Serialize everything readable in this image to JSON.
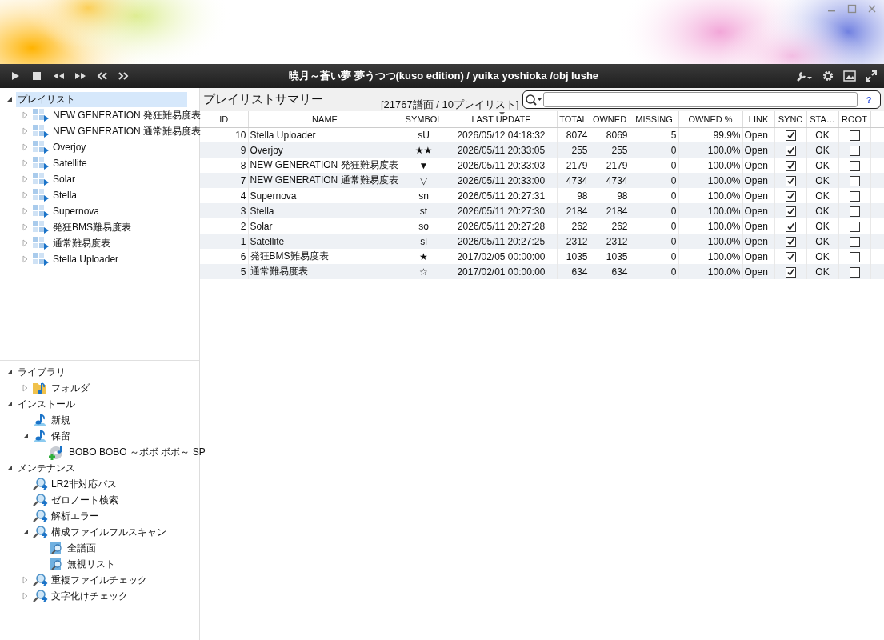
{
  "player": {
    "now_playing": "暁月～蒼い夢 夢うつつ(kuso edition) / yuika yoshioka /obj lushe"
  },
  "playlist_tree": [
    {
      "label": "プレイリスト",
      "selected": true,
      "expanded": true,
      "children": [
        {
          "label": "NEW GENERATION 発狂難易度表",
          "kind": "playlist",
          "selected": false,
          "expanded": false
        },
        {
          "label": "NEW GENERATION 通常難易度表",
          "kind": "playlist",
          "selected": false,
          "expanded": false
        },
        {
          "label": "Overjoy",
          "kind": "playlist",
          "selected": false,
          "expanded": false
        },
        {
          "label": "Satellite",
          "kind": "playlist",
          "selected": false,
          "expanded": false
        },
        {
          "label": "Solar",
          "kind": "playlist",
          "selected": false,
          "expanded": false
        },
        {
          "label": "Stella",
          "kind": "playlist",
          "selected": false,
          "expanded": false
        },
        {
          "label": "Supernova",
          "kind": "playlist",
          "selected": false,
          "expanded": false
        },
        {
          "label": "発狂BMS難易度表",
          "kind": "playlist",
          "selected": false,
          "expanded": false
        },
        {
          "label": "通常難易度表",
          "kind": "playlist",
          "selected": false,
          "expanded": false
        },
        {
          "label": "Stella Uploader",
          "kind": "playlist",
          "selected": false,
          "expanded": false
        }
      ]
    }
  ],
  "library_tree": [
    {
      "label": "ライブラリ",
      "selected": false,
      "expanded": true,
      "children": [
        {
          "label": "フォルダ",
          "kind": "folder",
          "selected": false,
          "expanded": false
        }
      ]
    },
    {
      "label": "インストール",
      "selected": false,
      "expanded": true,
      "children": [
        {
          "label": "新規",
          "kind": "music",
          "selected": false
        },
        {
          "label": "保留",
          "kind": "music",
          "selected": false,
          "expanded": true,
          "children": [
            {
              "label": "BOBO BOBO ～ボボ ボボ～ SP",
              "kind": "disc-add",
              "selected": false
            }
          ]
        }
      ]
    },
    {
      "label": "メンテナンス",
      "selected": false,
      "expanded": true,
      "children": [
        {
          "label": "LR2非対応パス",
          "kind": "scan",
          "selected": false
        },
        {
          "label": "ゼロノート検索",
          "kind": "scan",
          "selected": false
        },
        {
          "label": "解析エラー",
          "kind": "scan",
          "selected": false
        },
        {
          "label": "構成ファイルフルスキャン",
          "kind": "scan",
          "selected": false,
          "expanded": true,
          "children": [
            {
              "label": "全譜面",
              "kind": "scan-item",
              "selected": false
            },
            {
              "label": "無視リスト",
              "kind": "scan-item",
              "selected": false
            }
          ]
        },
        {
          "label": "重複ファイルチェック",
          "kind": "scan",
          "selected": false,
          "expanded": false
        },
        {
          "label": "文字化けチェック",
          "kind": "scan",
          "selected": false,
          "expanded": false
        }
      ]
    }
  ],
  "summary": {
    "title": "プレイリストサマリー",
    "count": "[21767譜面 / 10プレイリスト]",
    "search": {
      "help": "?"
    }
  },
  "table": {
    "columns": [
      {
        "label": "ID",
        "sorted_descending": false
      },
      {
        "label": "NAME",
        "sorted_descending": false
      },
      {
        "label": "SYMBOL",
        "sorted_descending": false
      },
      {
        "label": "LAST UPDATE",
        "sorted_descending": true
      },
      {
        "label": "TOTAL",
        "sorted_descending": false
      },
      {
        "label": "OWNED",
        "sorted_descending": false
      },
      {
        "label": "MISSING",
        "sorted_descending": false
      },
      {
        "label": "OWNED %",
        "sorted_descending": false
      },
      {
        "label": "LINK",
        "sorted_descending": false
      },
      {
        "label": "SYNC",
        "sorted_descending": false
      },
      {
        "label": "STA…",
        "sorted_descending": false
      },
      {
        "label": "ROOT",
        "sorted_descending": false
      }
    ],
    "rows": [
      {
        "id": "10",
        "name": "Stella Uploader",
        "symbol": "sU",
        "last_update": "2026/05/12 04:18:32",
        "total": "8074",
        "owned": "8069",
        "missing": "5",
        "owned_pct": "99.9%",
        "link": "Open",
        "sync": true,
        "status": "OK",
        "root": false
      },
      {
        "id": "9",
        "name": "Overjoy",
        "symbol": "★★",
        "last_update": "2026/05/11 20:33:05",
        "total": "255",
        "owned": "255",
        "missing": "0",
        "owned_pct": "100.0%",
        "link": "Open",
        "sync": true,
        "status": "OK",
        "root": false
      },
      {
        "id": "8",
        "name": "NEW GENERATION 発狂難易度表",
        "symbol": "▼",
        "last_update": "2026/05/11 20:33:03",
        "total": "2179",
        "owned": "2179",
        "missing": "0",
        "owned_pct": "100.0%",
        "link": "Open",
        "sync": true,
        "status": "OK",
        "root": false
      },
      {
        "id": "7",
        "name": "NEW GENERATION 通常難易度表",
        "symbol": "▽",
        "last_update": "2026/05/11 20:33:00",
        "total": "4734",
        "owned": "4734",
        "missing": "0",
        "owned_pct": "100.0%",
        "link": "Open",
        "sync": true,
        "status": "OK",
        "root": false
      },
      {
        "id": "4",
        "name": "Supernova",
        "symbol": "sn",
        "last_update": "2026/05/11 20:27:31",
        "total": "98",
        "owned": "98",
        "missing": "0",
        "owned_pct": "100.0%",
        "link": "Open",
        "sync": true,
        "status": "OK",
        "root": false
      },
      {
        "id": "3",
        "name": "Stella",
        "symbol": "st",
        "last_update": "2026/05/11 20:27:30",
        "total": "2184",
        "owned": "2184",
        "missing": "0",
        "owned_pct": "100.0%",
        "link": "Open",
        "sync": true,
        "status": "OK",
        "root": false
      },
      {
        "id": "2",
        "name": "Solar",
        "symbol": "so",
        "last_update": "2026/05/11 20:27:28",
        "total": "262",
        "owned": "262",
        "missing": "0",
        "owned_pct": "100.0%",
        "link": "Open",
        "sync": true,
        "status": "OK",
        "root": false
      },
      {
        "id": "1",
        "name": "Satellite",
        "symbol": "sl",
        "last_update": "2026/05/11 20:27:25",
        "total": "2312",
        "owned": "2312",
        "missing": "0",
        "owned_pct": "100.0%",
        "link": "Open",
        "sync": true,
        "status": "OK",
        "root": false
      },
      {
        "id": "6",
        "name": "発狂BMS難易度表",
        "symbol": "★",
        "last_update": "2017/02/05 00:00:00",
        "total": "1035",
        "owned": "1035",
        "missing": "0",
        "owned_pct": "100.0%",
        "link": "Open",
        "sync": true,
        "status": "OK",
        "root": false
      },
      {
        "id": "5",
        "name": "通常難易度表",
        "symbol": "☆",
        "last_update": "2017/02/01 00:00:00",
        "total": "634",
        "owned": "634",
        "missing": "0",
        "owned_pct": "100.0%",
        "link": "Open",
        "sync": true,
        "status": "OK",
        "root": false
      }
    ]
  }
}
